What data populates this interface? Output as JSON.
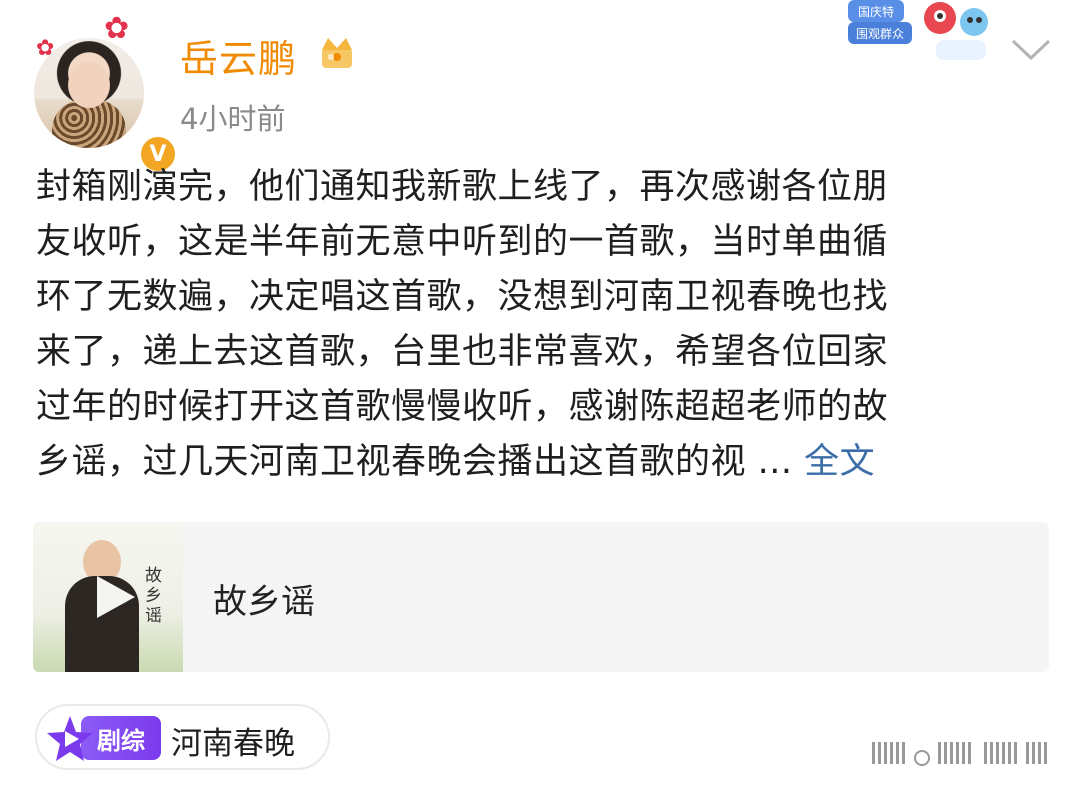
{
  "post": {
    "username": "岳云鹏",
    "timestamp": "4小时前",
    "text_lines": [
      "封箱刚演完，他们通知我新歌上线了，再次感谢各位朋",
      "友收听，这是半年前无意中听到的一首歌，当时单曲循",
      "环了无数遍，决定唱这首歌，没想到河南卫视春晚也找",
      "来了，递上去这首歌，台里也非常喜欢，希望各位回家",
      "过年的时候打开这首歌慢慢收听，感谢陈超超老师的故",
      "乡谣，过几天河南卫视春晚会播出这首歌的视 ..."
    ],
    "more_label": "全文"
  },
  "festival_badge": {
    "line1": "国庆特",
    "line2": "围观群众"
  },
  "media": {
    "song_title": "故乡谣",
    "thumb_calligraphy": "故乡谣"
  },
  "topic": {
    "badge": "剧综",
    "label": "河南春晚"
  },
  "colors": {
    "username": "#f08a00",
    "link": "#3b6ea8",
    "timestamp": "#8a8a8a",
    "badge_purple": "#7c3aed"
  }
}
